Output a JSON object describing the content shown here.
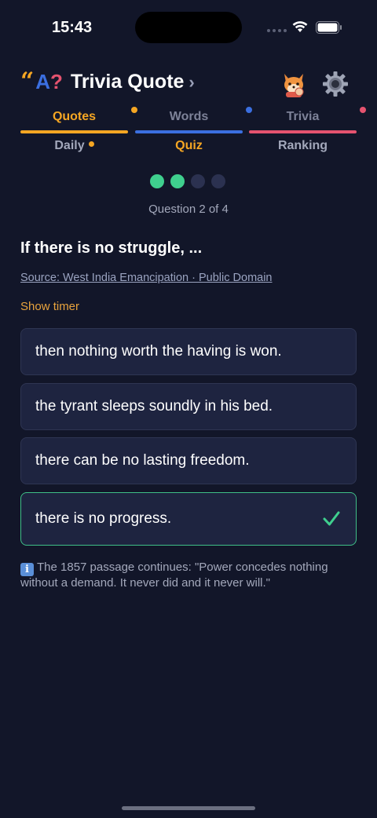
{
  "status_bar": {
    "time": "15:43"
  },
  "header": {
    "logo_quote": "“",
    "logo_a": "A",
    "logo_q": "?",
    "title": "Trivia Quote",
    "chevron": "›"
  },
  "tabs_primary": [
    {
      "label": "Quotes",
      "color": "#f5a623",
      "bar_color": "#f5a623",
      "dot_color": "#f5a623",
      "active": true
    },
    {
      "label": "Words",
      "color": "#7d8298",
      "bar_color": "#3b6fe0",
      "dot_color": "#3b6fe0",
      "active": false
    },
    {
      "label": "Trivia",
      "color": "#7d8298",
      "bar_color": "#e5536f",
      "dot_color": "#e5536f",
      "active": false
    }
  ],
  "tabs_secondary": [
    {
      "label": "Daily",
      "color": "#a3a8bb",
      "has_dot": true
    },
    {
      "label": "Quiz",
      "color": "#f5a623",
      "has_dot": false
    },
    {
      "label": "Ranking",
      "color": "#a3a8bb",
      "has_dot": false
    }
  ],
  "progress": {
    "completed_color": "#3fcf8e",
    "pending_color": "#2b3150",
    "dots": [
      "done",
      "done",
      "pending",
      "pending"
    ]
  },
  "quiz": {
    "counter": "Question 2 of 4",
    "question": "If there is no struggle, ...",
    "source": "Source: West India Emancipation · Public Domain",
    "timer_link": "Show timer",
    "options": [
      {
        "text": "then nothing worth the having is won.",
        "correct": false
      },
      {
        "text": "the tyrant sleeps soundly in his bed.",
        "correct": false
      },
      {
        "text": "there can be no lasting freedom.",
        "correct": false
      },
      {
        "text": "there is no progress.",
        "correct": true
      }
    ],
    "check_icon": "checkmark-icon",
    "info_icon": "i",
    "info_text": "The 1857 passage continues: \"Power concedes nothing without a demand. It never did and it never will.\""
  },
  "colors": {
    "background": "#121629",
    "card": "#1e2440",
    "accent": "#f5a623",
    "correct": "#3fbf87"
  }
}
